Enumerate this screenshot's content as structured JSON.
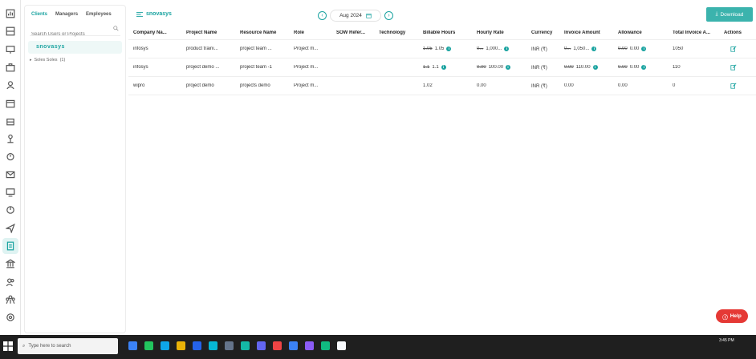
{
  "sidebar_icons": [
    "dashboard-icon",
    "grid-icon",
    "monitor-icon",
    "briefcase-icon",
    "user-icon",
    "calendar-icon",
    "bag-icon",
    "person-icon",
    "alarm-icon",
    "mail-icon",
    "desktop-icon",
    "pie-icon",
    "send-icon",
    "document-icon",
    "bank-icon",
    "users-icon",
    "team-icon",
    "settings-icon"
  ],
  "client_panel": {
    "tabs": [
      "Clients",
      "Managers",
      "Employees"
    ],
    "active_tab": "Clients",
    "search_placeholder": "Search Users or Projects",
    "selected_client": "snovasys",
    "tree_item": "Soles Soles",
    "tree_count": "(1)"
  },
  "topbar": {
    "title": "snovasys",
    "month": "Aug 2024",
    "prev_label": "‹",
    "next_label": "›",
    "download_label": "Download"
  },
  "table": {
    "headers": [
      "Company Na...",
      "Project Name",
      "Resource Name",
      "Role",
      "SOW Refer...",
      "Technology",
      "Billable Hours",
      "Hourly Rate",
      "Currency",
      "Invoice Amount",
      "Allowance",
      "Total Invoice A...",
      "Actions"
    ],
    "rows": [
      {
        "company": "infosys",
        "project": "product traini...",
        "resource": "project team ...",
        "role": "Project m...",
        "sow": "",
        "technology": "",
        "billable_old": "1.05",
        "billable_new": "1.05",
        "rate_old": "0...",
        "rate_new": "1,000...",
        "currency": "INR (₹)",
        "invoice_old": "0...",
        "invoice_new": "1,050...",
        "allowance_old": "0.00",
        "allowance_new": "0.00",
        "total": "1050"
      },
      {
        "company": "infosys",
        "project": "project demo ...",
        "resource": "project team -1",
        "role": "Project m...",
        "sow": "",
        "technology": "",
        "billable_old": "1.1",
        "billable_new": "1.1",
        "rate_old": "0.00",
        "rate_new": "100.00",
        "currency": "INR (₹)",
        "invoice_old": "0.00",
        "invoice_new": "110.00",
        "allowance_old": "0.00",
        "allowance_new": "0.00",
        "total": "110"
      },
      {
        "company": "wipro",
        "project": "project demo",
        "resource": "projects demo",
        "role": "Project m...",
        "sow": "",
        "technology": "",
        "billable_old": "",
        "billable_new": "1.02",
        "rate_old": "",
        "rate_new": "0.00",
        "currency": "INR (₹)",
        "invoice_old": "",
        "invoice_new": "0.00",
        "allowance_old": "",
        "allowance_new": "0.00",
        "total": "0"
      }
    ]
  },
  "help_label": "Help",
  "taskbar": {
    "search_placeholder": "Type here to search",
    "time": "3:45 PM"
  },
  "colors": {
    "accent": "#1aa3a0",
    "download": "#3bb3ad",
    "help": "#e53935"
  }
}
